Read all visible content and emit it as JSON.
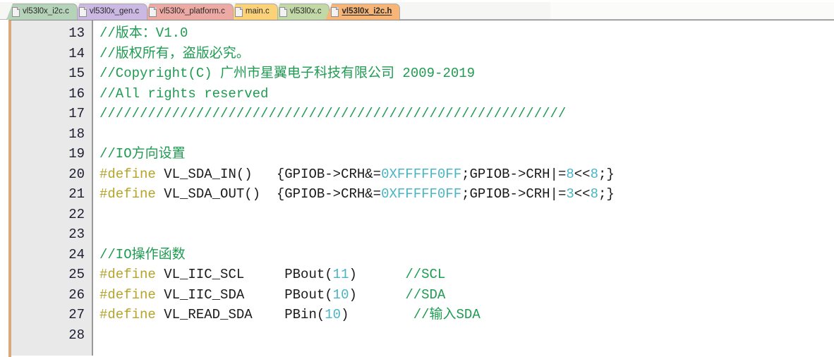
{
  "window": {
    "title": "vl53l0x_i2c.h"
  },
  "tabbar": {
    "tabs": [
      {
        "label": "vl53l0x_i2c.c",
        "color": "#b5d3b8",
        "active": false,
        "icon": "document-icon"
      },
      {
        "label": "vl53l0x_gen.c",
        "color": "#cbb8e3",
        "active": false,
        "icon": "document-icon"
      },
      {
        "label": "vl53l0x_platform.c",
        "color": "#eda9a4",
        "active": false,
        "icon": "document-icon"
      },
      {
        "label": "main.c",
        "color": "#fbd278",
        "active": false,
        "icon": "document-icon"
      },
      {
        "label": "vl53l0x.c",
        "color": "#c2d8a6",
        "active": false,
        "icon": "document-icon"
      },
      {
        "label": "vl53l0x_i2c.h",
        "color": "#f7b678",
        "active": true,
        "icon": "document-icon"
      }
    ]
  },
  "editor": {
    "gutter": [
      "13",
      "14",
      "15",
      "16",
      "17",
      "18",
      "19",
      "20",
      "21",
      "22",
      "23",
      "24",
      "25",
      "26",
      "27",
      "28"
    ],
    "lines": [
      {
        "num": "13",
        "tokens": [
          {
            "t": "cmt",
            "v": "//版本：V1.0"
          }
        ]
      },
      {
        "num": "14",
        "tokens": [
          {
            "t": "cmt",
            "v": "//版权所有，盗版必究。"
          }
        ]
      },
      {
        "num": "15",
        "tokens": [
          {
            "t": "cmt",
            "v": "//Copyright(C) 广州市星翼电子科技有限公司 2009-2019"
          }
        ]
      },
      {
        "num": "16",
        "tokens": [
          {
            "t": "cmt",
            "v": "//All rights reserved"
          }
        ]
      },
      {
        "num": "17",
        "tokens": [
          {
            "t": "cmt",
            "v": "//////////////////////////////////////////////////////////"
          }
        ]
      },
      {
        "num": "18",
        "tokens": []
      },
      {
        "num": "19",
        "tokens": [
          {
            "t": "cmt",
            "v": "//IO方向设置"
          }
        ]
      },
      {
        "num": "20",
        "tokens": [
          {
            "t": "pp",
            "v": "#define"
          },
          {
            "t": "txt",
            "v": " VL_SDA_IN()   {GPIOB->CRH&="
          },
          {
            "t": "num",
            "v": "0XFFFFF0FF"
          },
          {
            "t": "txt",
            "v": ";GPIOB->CRH|="
          },
          {
            "t": "num",
            "v": "8"
          },
          {
            "t": "txt",
            "v": "<<"
          },
          {
            "t": "num",
            "v": "8"
          },
          {
            "t": "txt",
            "v": ";}"
          }
        ]
      },
      {
        "num": "21",
        "tokens": [
          {
            "t": "pp",
            "v": "#define"
          },
          {
            "t": "txt",
            "v": " VL_SDA_OUT()  {GPIOB->CRH&="
          },
          {
            "t": "num",
            "v": "0XFFFFF0FF"
          },
          {
            "t": "txt",
            "v": ";GPIOB->CRH|="
          },
          {
            "t": "num",
            "v": "3"
          },
          {
            "t": "txt",
            "v": "<<"
          },
          {
            "t": "num",
            "v": "8"
          },
          {
            "t": "txt",
            "v": ";}"
          }
        ]
      },
      {
        "num": "22",
        "tokens": []
      },
      {
        "num": "23",
        "tokens": []
      },
      {
        "num": "24",
        "tokens": [
          {
            "t": "cmt",
            "v": "//IO操作函数"
          }
        ]
      },
      {
        "num": "25",
        "tokens": [
          {
            "t": "pp",
            "v": "#define"
          },
          {
            "t": "txt",
            "v": " VL_IIC_SCL     PBout("
          },
          {
            "t": "num",
            "v": "11"
          },
          {
            "t": "txt",
            "v": ")      "
          },
          {
            "t": "cmt",
            "v": "//SCL"
          }
        ]
      },
      {
        "num": "26",
        "tokens": [
          {
            "t": "pp",
            "v": "#define"
          },
          {
            "t": "txt",
            "v": " VL_IIC_SDA     PBout("
          },
          {
            "t": "num",
            "v": "10"
          },
          {
            "t": "txt",
            "v": ")      "
          },
          {
            "t": "cmt",
            "v": "//SDA"
          }
        ]
      },
      {
        "num": "27",
        "tokens": [
          {
            "t": "pp",
            "v": "#define"
          },
          {
            "t": "txt",
            "v": " VL_READ_SDA    PBin("
          },
          {
            "t": "num",
            "v": "10"
          },
          {
            "t": "txt",
            "v": ")        "
          },
          {
            "t": "cmt",
            "v": "//输入SDA"
          }
        ]
      },
      {
        "num": "28",
        "tokens": []
      }
    ],
    "colors": {
      "comment": "#1f9c52",
      "preprocessor": "#b5a42a",
      "number": "#4ab5c4",
      "text": "#1b1b1b",
      "gutter_bg": "#e9e9e9",
      "gutter_text": "#1d1d32",
      "editor_bg": "#ffffff",
      "left_border": "#d9a97c"
    }
  }
}
